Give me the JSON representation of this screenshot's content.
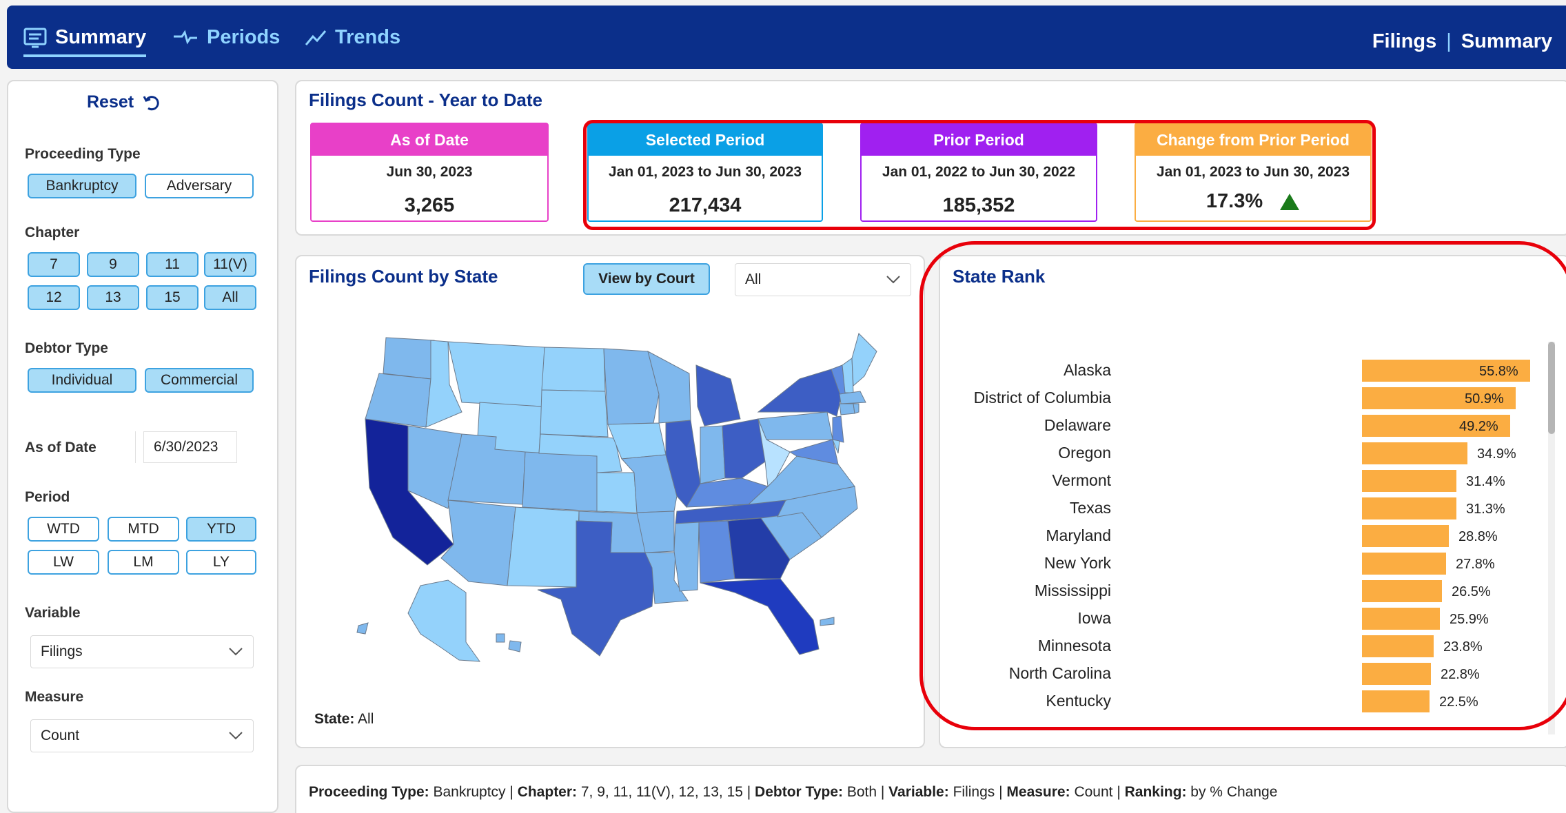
{
  "nav": {
    "tabs": [
      {
        "label": "Summary",
        "icon": "report-icon"
      },
      {
        "label": "Periods",
        "icon": "periods-icon"
      },
      {
        "label": "Trends",
        "icon": "trend-icon"
      }
    ],
    "breadcrumb": {
      "section": "Filings",
      "page": "Summary"
    }
  },
  "sidebar": {
    "reset_label": "Reset",
    "proceeding_type": {
      "label": "Proceeding Type",
      "options": [
        "Bankruptcy",
        "Adversary"
      ],
      "selected": [
        "Bankruptcy"
      ]
    },
    "chapter": {
      "label": "Chapter",
      "options": [
        "7",
        "9",
        "11",
        "11(V)",
        "12",
        "13",
        "15",
        "All"
      ]
    },
    "debtor_type": {
      "label": "Debtor Type",
      "options": [
        "Individual",
        "Commercial"
      ]
    },
    "as_of_date": {
      "label": "As of Date",
      "value": "6/30/2023"
    },
    "period": {
      "label": "Period",
      "options": [
        "WTD",
        "MTD",
        "YTD",
        "LW",
        "LM",
        "LY"
      ],
      "selected": "YTD"
    },
    "variable": {
      "label": "Variable",
      "value": "Filings"
    },
    "measure": {
      "label": "Measure",
      "value": "Count"
    }
  },
  "ytd": {
    "title": "Filings Count - Year to Date",
    "cards": [
      {
        "header": "As of Date",
        "period": "Jun 30, 2023",
        "value": "3,265",
        "color": "#e840c8"
      },
      {
        "header": "Selected Period",
        "period": "Jan 01, 2023 to Jun 30, 2023",
        "value": "217,434",
        "color": "#0aa0e6"
      },
      {
        "header": "Prior Period",
        "period": "Jan 01, 2022 to Jun 30, 2022",
        "value": "185,352",
        "color": "#a020f0"
      },
      {
        "header": "Change from Prior Period",
        "period": "Jan 01, 2023 to Jun 30, 2023",
        "value": "17.3%",
        "color": "#fbad42"
      }
    ]
  },
  "map_panel": {
    "title": "Filings Count by State",
    "view_button": "View by Court",
    "filter_value": "All",
    "state_label": "State:",
    "state_value": "All"
  },
  "rank_panel": {
    "title": "State Rank",
    "items": [
      {
        "state": "Alaska",
        "pct": "55.8%",
        "value": 55.8
      },
      {
        "state": "District of Columbia",
        "pct": "50.9%",
        "value": 50.9
      },
      {
        "state": "Delaware",
        "pct": "49.2%",
        "value": 49.2
      },
      {
        "state": "Oregon",
        "pct": "34.9%",
        "value": 34.9
      },
      {
        "state": "Vermont",
        "pct": "31.4%",
        "value": 31.4
      },
      {
        "state": "Texas",
        "pct": "31.3%",
        "value": 31.3
      },
      {
        "state": "Maryland",
        "pct": "28.8%",
        "value": 28.8
      },
      {
        "state": "New York",
        "pct": "27.8%",
        "value": 27.8
      },
      {
        "state": "Mississippi",
        "pct": "26.5%",
        "value": 26.5
      },
      {
        "state": "Iowa",
        "pct": "25.9%",
        "value": 25.9
      },
      {
        "state": "Minnesota",
        "pct": "23.8%",
        "value": 23.8
      },
      {
        "state": "North Carolina",
        "pct": "22.8%",
        "value": 22.8
      },
      {
        "state": "Kentucky",
        "pct": "22.5%",
        "value": 22.5
      }
    ],
    "bar_color": "#fbad42"
  },
  "footer": {
    "proceeding_label": "Proceeding Type:",
    "proceeding_value": "Bankruptcy",
    "chapter_label": "Chapter:",
    "chapter_value": "7, 9, 11, 11(V), 12, 13, 15",
    "debtor_label": "Debtor Type:",
    "debtor_value": "Both",
    "variable_label": "Variable:",
    "variable_value": "Filings",
    "measure_label": "Measure:",
    "measure_value": "Count",
    "ranking_label": "Ranking:",
    "ranking_value": "by % Change"
  }
}
